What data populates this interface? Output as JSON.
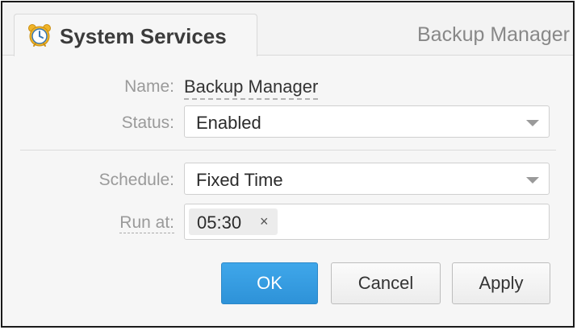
{
  "header": {
    "tab_title": "System Services",
    "tab_icon": "alarm-clock-icon",
    "context_title": "Backup Manager"
  },
  "form": {
    "name_label": "Name:",
    "name_value": "Backup Manager",
    "status_label": "Status:",
    "status_value": "Enabled",
    "schedule_label": "Schedule:",
    "schedule_value": "Fixed Time",
    "run_at_label": "Run at:",
    "run_at_tags": [
      "05:30"
    ],
    "tag_remove": "×"
  },
  "buttons": {
    "ok": "OK",
    "cancel": "Cancel",
    "apply": "Apply"
  },
  "colors": {
    "primary": "#3fa7ea",
    "clock_blue": "#3a78b5",
    "clock_gold": "#f0b428"
  }
}
